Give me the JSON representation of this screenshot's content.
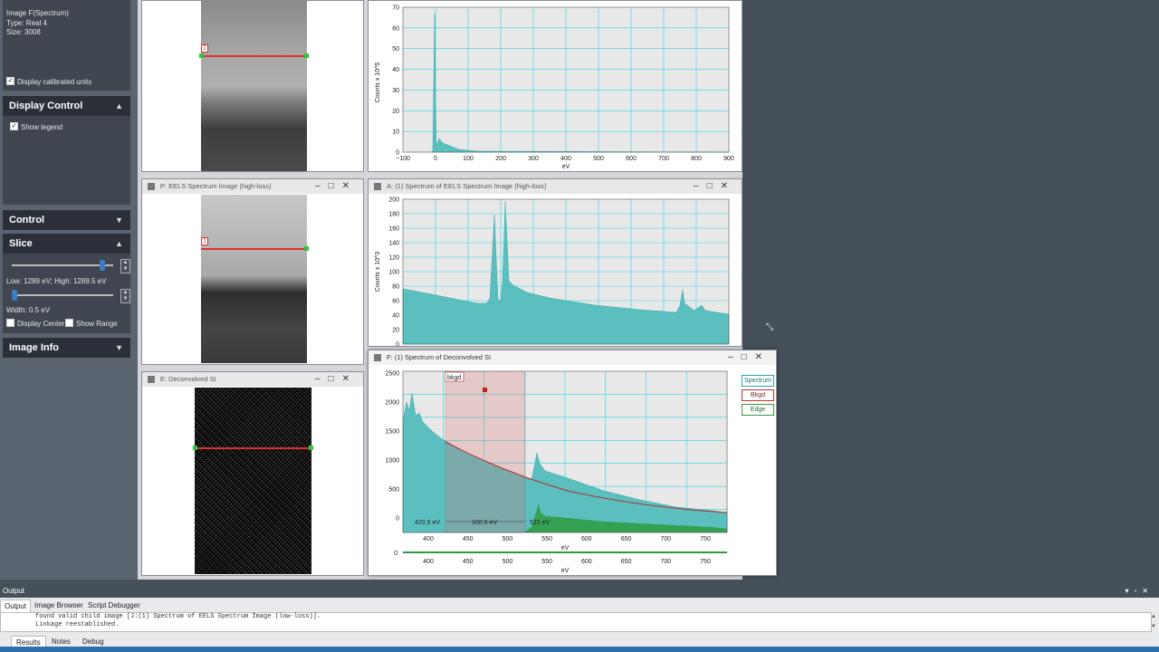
{
  "info_panel": {
    "image_name": "Image F(Spectrum)",
    "type_line": "Type:   Real 4",
    "size_line": "Size:    3008",
    "display_calibrated": "Display calibrated units"
  },
  "display_control": {
    "title": "Display Control",
    "show_legend": "Show legend"
  },
  "control": {
    "title": "Control"
  },
  "slice": {
    "title": "Slice",
    "low_high": "Low: 1289 eV; High: 1289.5 eV",
    "width": "Width: 0.5 eV",
    "display_center": "Display Center",
    "show_range": "Show Range"
  },
  "image_info": {
    "title": "Image Info"
  },
  "windows": {
    "p_title": "P: EELS Spectrum Image (high-loss)",
    "e_title": "E: Deconvolved SI",
    "a_title": "A: (1) Spectrum of EELS Spectrum Image (high-loss)",
    "f_title": "F: (1) Spectrum of Deconvolved SI",
    "roi_label": "1"
  },
  "top_plot": {
    "ylabel": "Counts x 10^5",
    "xlabel": "eV",
    "yticks": [
      "0",
      "10",
      "20",
      "30",
      "40",
      "50",
      "60",
      "70"
    ],
    "xticks": [
      "−100",
      "0",
      "100",
      "200",
      "300",
      "400",
      "500",
      "600",
      "700",
      "800",
      "900"
    ]
  },
  "a_plot": {
    "ylabel": "Counts x 10^3",
    "yticks": [
      "0",
      "20",
      "40",
      "60",
      "80",
      "100",
      "120",
      "140",
      "160",
      "180",
      "200"
    ]
  },
  "f_plot": {
    "yticks": [
      "0",
      "500",
      "1000",
      "1500",
      "2000",
      "2500"
    ],
    "xticks": [
      "400",
      "450",
      "500",
      "550",
      "600",
      "650",
      "700",
      "750"
    ],
    "xlabel": "eV",
    "bkgd_tag": "bkgd",
    "range_start": "420.5 eV",
    "range_width": "100.5 eV",
    "range_end": "521 eV",
    "legend": [
      "Spectrum",
      "Bkgd",
      "Edge"
    ],
    "lower_xticks": [
      "400",
      "450",
      "500",
      "550",
      "600",
      "650",
      "700",
      "750"
    ],
    "lower_ytick": "0"
  },
  "output": {
    "header": "Output",
    "tabs": [
      "Output",
      "Image Browser",
      "Script Debugger"
    ],
    "lines": [
      "found valid child image [J:(1) Spectrum of EELS Spectrum Image (low-loss)].",
      "Linkage reestablished."
    ],
    "bottom_tabs": [
      "Results",
      "Notes",
      "Debug"
    ]
  },
  "colors": {
    "spectrum": "#5bbfbf",
    "grid": "#2ad4e0",
    "roi_line": "#e03030",
    "bkgd_fit": "#b03030",
    "edge": "#2e9a3e"
  }
}
